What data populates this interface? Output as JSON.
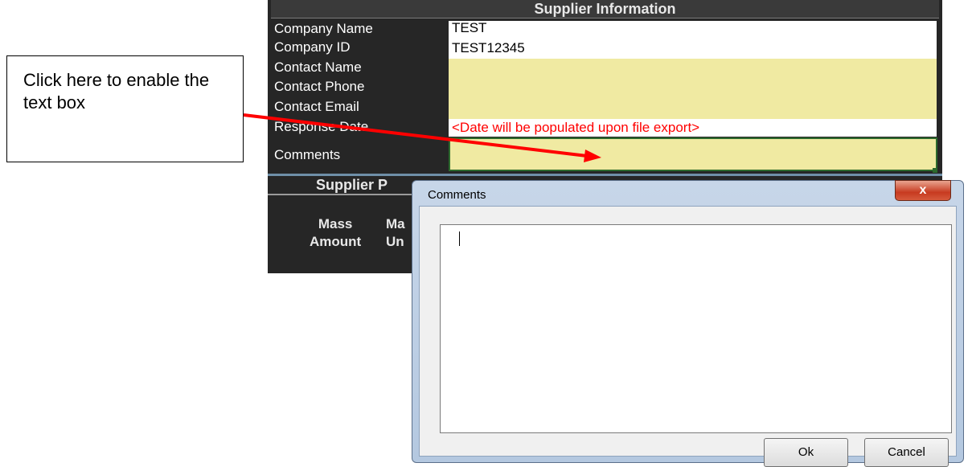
{
  "sheet": {
    "title_cutoff": "Supplier Information",
    "header": "Supplier Information",
    "rows": [
      {
        "label": "Company Name",
        "value": "TEST"
      },
      {
        "label": "Company ID",
        "value": "TEST12345"
      },
      {
        "label": "Contact Name",
        "value": ""
      },
      {
        "label": "Contact  Phone",
        "value": ""
      },
      {
        "label": "Contact Email",
        "value": ""
      },
      {
        "label": "Response Date",
        "value": "<Date will be populated upon file export>"
      },
      {
        "label": "Comments",
        "value": ""
      }
    ],
    "sub_header": "Supplier P",
    "col_1": {
      "line1": "Mass",
      "line2": "Amount"
    },
    "col_2": {
      "line1": "Ma",
      "line2": "Un"
    }
  },
  "callout": {
    "text": "Click here to enable the text box"
  },
  "dialog": {
    "title": "Comments",
    "close": "x",
    "textarea_value": "",
    "ok_label": "Ok",
    "cancel_label": "Cancel"
  },
  "colors": {
    "highlight_yellow": "#f0eaa2",
    "red": "#ff0000",
    "dark_bg": "#262626"
  }
}
